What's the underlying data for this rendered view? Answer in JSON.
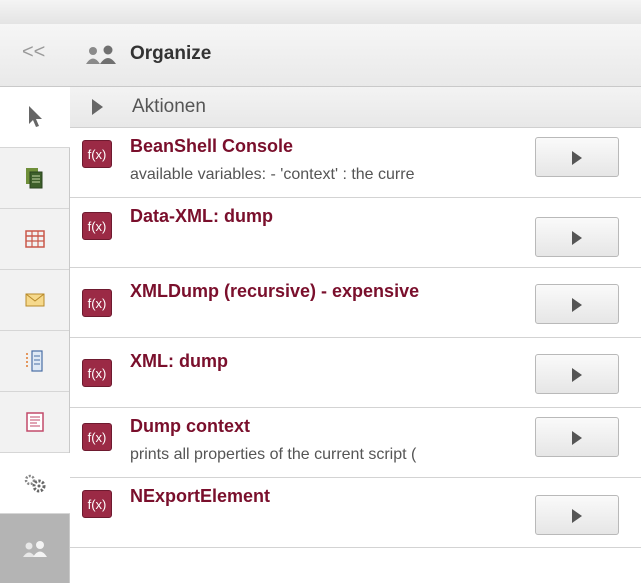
{
  "header": {
    "collapse_label": "<<",
    "title": "Organize"
  },
  "section": {
    "label": "Aktionen"
  },
  "actions": [
    {
      "icon": "f(x)",
      "title": "BeanShell Console",
      "description": "available variables: - 'context' : the curre"
    },
    {
      "icon": "f(x)",
      "title": "Data-XML: dump",
      "description": ""
    },
    {
      "icon": "f(x)",
      "title": "XMLDump (recursive) - expensive",
      "description": ""
    },
    {
      "icon": "f(x)",
      "title": "XML: dump",
      "description": ""
    },
    {
      "icon": "f(x)",
      "title": "Dump context",
      "description": "prints all properties of the current script ("
    },
    {
      "icon": "f(x)",
      "title": "NExportElement",
      "description": ""
    }
  ],
  "sidebar": {
    "tabs": [
      {
        "name": "cursor-icon"
      },
      {
        "name": "documents-icon"
      },
      {
        "name": "table-icon"
      },
      {
        "name": "envelope-icon"
      },
      {
        "name": "form-icon"
      },
      {
        "name": "report-icon"
      },
      {
        "name": "gears-icon"
      },
      {
        "name": "users-icon"
      }
    ]
  },
  "colors": {
    "accent": "#9b2a45",
    "title_text": "#7a0f2c",
    "active_tab": "#b4b4b4"
  }
}
